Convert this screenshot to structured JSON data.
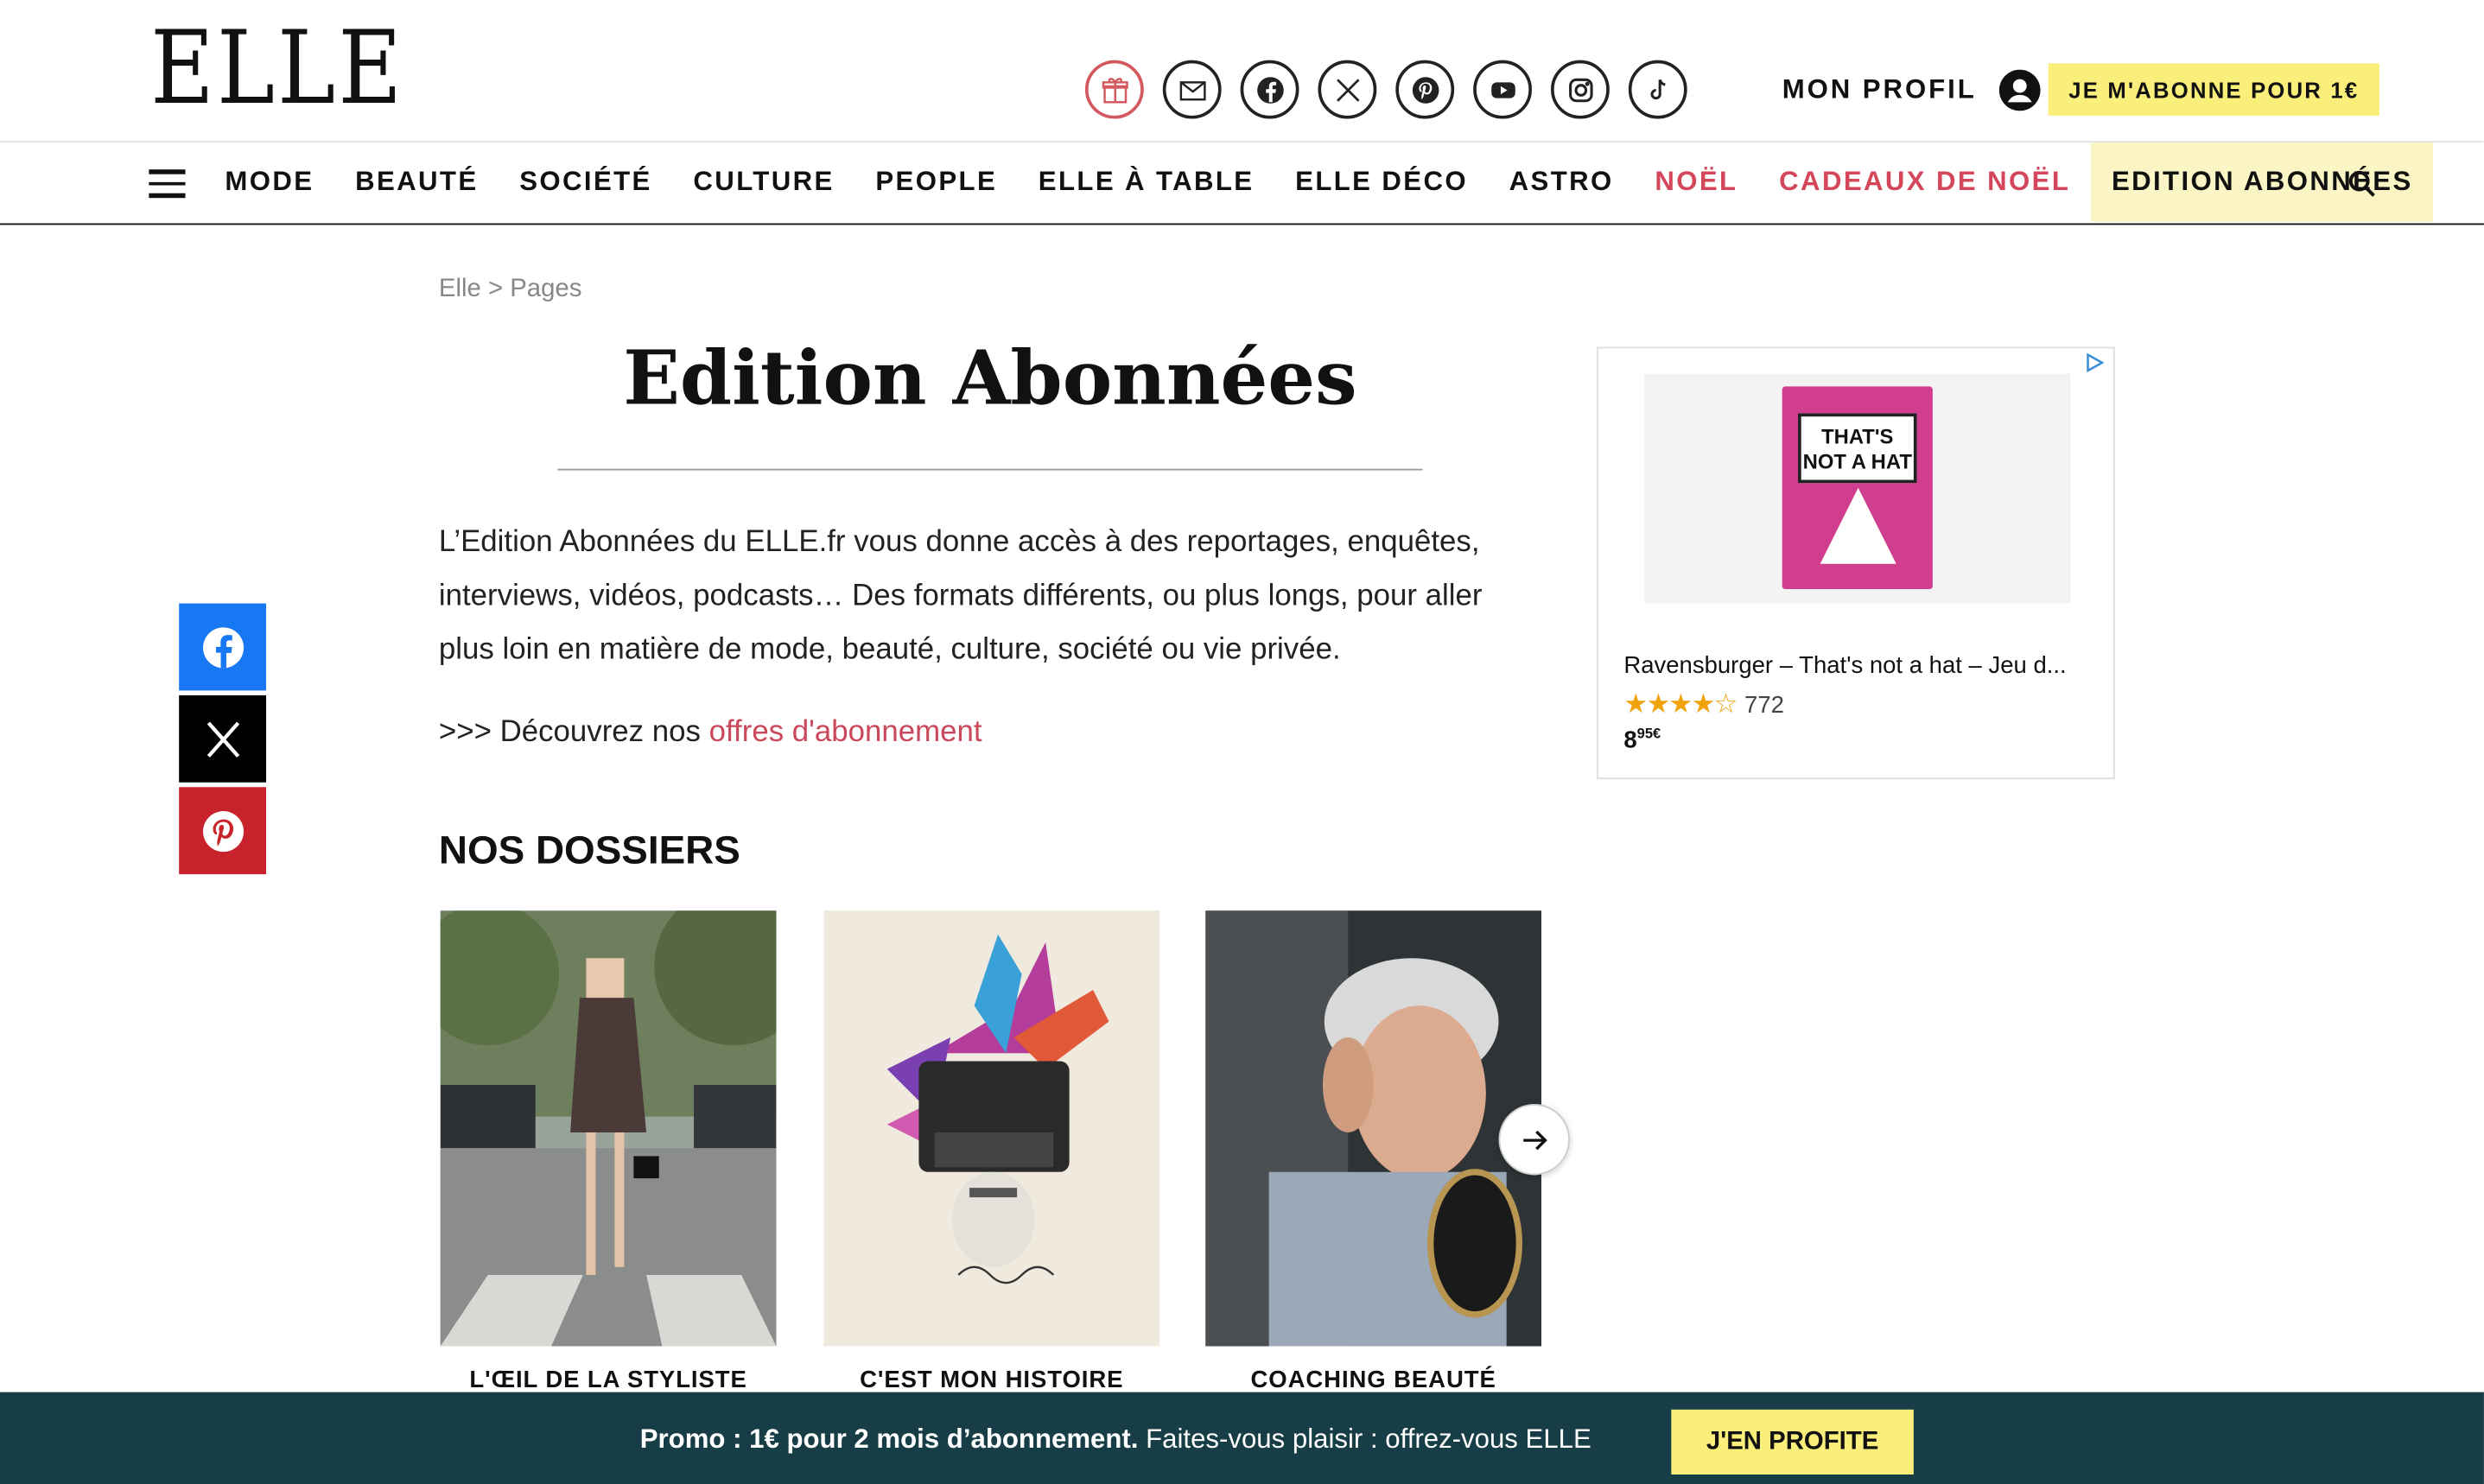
{
  "header": {
    "logo": "ELLE",
    "profile_label": "MON PROFIL",
    "subscribe_label": "JE M'ABONNE POUR 1€"
  },
  "social_icons": [
    "gift-icon",
    "mail-icon",
    "facebook-icon",
    "x-icon",
    "pinterest-icon",
    "youtube-icon",
    "instagram-icon",
    "tiktok-icon"
  ],
  "nav": {
    "items": [
      {
        "label": "MODE"
      },
      {
        "label": "BEAUTÉ"
      },
      {
        "label": "SOCIÉTÉ"
      },
      {
        "label": "CULTURE"
      },
      {
        "label": "PEOPLE"
      },
      {
        "label": "ELLE À TABLE"
      },
      {
        "label": "ELLE DÉCO"
      },
      {
        "label": "ASTRO"
      },
      {
        "label": "NOËL"
      },
      {
        "label": "CADEAUX DE NOËL"
      },
      {
        "label": "EDITION ABONNÉES"
      }
    ]
  },
  "breadcrumb": "Elle > Pages",
  "page": {
    "title": "Edition Abonnées",
    "intro": "L’Edition Abonnées du ELLE.fr vous donne accès à des reportages, enquêtes, interviews, vidéos, podcasts… Des formats différents, ou plus longs, pour aller plus loin en matière de mode, beauté, culture, société ou vie privée.",
    "discover_prefix": ">>> Découvrez nos ",
    "discover_link": "offres d'abonnement"
  },
  "ad": {
    "box_text": "THAT'S NOT A HAT",
    "title": "Ravensburger – That's not a hat – Jeu d...",
    "stars": "★★★★☆",
    "rating_count": "772",
    "price_main": "8",
    "price_sup": "95€"
  },
  "dossiers": {
    "heading": "NOS DOSSIERS",
    "cards": [
      {
        "label": "L'ŒIL DE LA STYLISTE"
      },
      {
        "label": "C'EST MON HISTOIRE"
      },
      {
        "label": "COACHING BEAUTÉ"
      }
    ]
  },
  "promo": {
    "bold": "Promo : 1€ pour 2 mois d’abonnement.",
    "text": " Faites-vous plaisir : offrez-vous ELLE",
    "button": "J'EN PROFITE"
  },
  "colors": {
    "accent_yellow": "#f9ef7a",
    "accent_red": "#d4475a",
    "promo_bg": "#173e46",
    "facebook": "#1877f2",
    "x": "#000000",
    "pinterest": "#c8232c"
  }
}
